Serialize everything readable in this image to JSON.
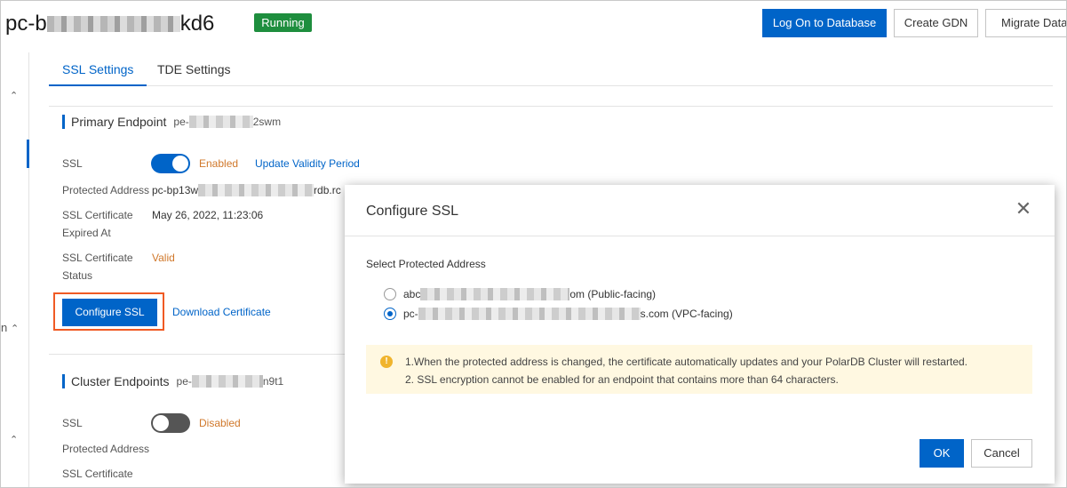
{
  "header": {
    "title_prefix": "pc-b",
    "title_suffix": "kd6",
    "status": "Running",
    "buttons": {
      "log_on": "Log On to Database",
      "create_gdn": "Create GDN",
      "migrate": "Migrate Data t"
    }
  },
  "sidebar": {
    "partial_label": "n"
  },
  "tabs": [
    {
      "label": "SSL Settings",
      "active": true
    },
    {
      "label": "TDE Settings",
      "active": false
    }
  ],
  "primary": {
    "title": "Primary Endpoint",
    "endpoint_prefix": "pe-",
    "endpoint_suffix": "2swm",
    "ssl_label": "SSL",
    "ssl_status": "Enabled",
    "update_link": "Update Validity Period",
    "protected_label": "Protected Address",
    "protected_prefix": "pc-bp13w",
    "protected_suffix": "rdb.rc",
    "expire_label_1": "SSL Certificate",
    "expire_label_2": "Expired At",
    "expire_value": "May 26, 2022, 11:23:06",
    "status_label_1": "SSL Certificate",
    "status_label_2": "Status",
    "status_value": "Valid",
    "configure_button": "Configure SSL",
    "download_link": "Download Certificate"
  },
  "cluster": {
    "title": "Cluster Endpoints",
    "endpoint_prefix": "pe-",
    "endpoint_suffix": "n9t1",
    "ssl_label": "SSL",
    "ssl_status": "Disabled",
    "protected_label": "Protected Address",
    "cert_label": "SSL Certificate"
  },
  "modal": {
    "title": "Configure SSL",
    "select_label": "Select Protected Address",
    "options": [
      {
        "prefix": "abc",
        "suffix": "om (Public-facing)",
        "checked": false
      },
      {
        "prefix": "pc-",
        "suffix": "s.com (VPC-facing)",
        "checked": true
      }
    ],
    "notice_icon": "!",
    "notice_lines": [
      "1.When the protected address is changed, the certificate automatically updates and your PolarDB Cluster will restarted.",
      "2. SSL encryption cannot be enabled for an endpoint that contains more than 64 characters."
    ],
    "ok": "OK",
    "cancel": "Cancel",
    "close_glyph": "✕"
  },
  "colors": {
    "primary_blue": "#0064c8",
    "running_green": "#1e8e3e",
    "status_orange": "#d0782b",
    "highlight_red": "#f05a24",
    "notice_bg": "#fff8e1"
  }
}
